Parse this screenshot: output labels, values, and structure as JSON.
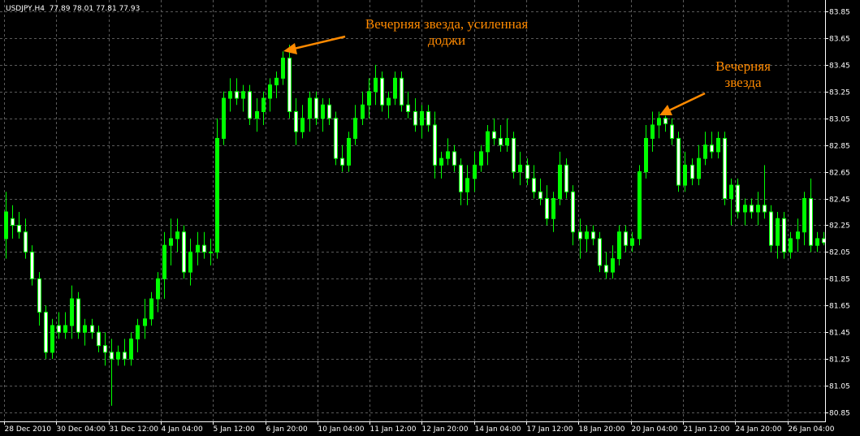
{
  "header": {
    "symbol": "USDJPY,H4",
    "ohlc": "77.89 78.01 77.81 77.93"
  },
  "annotations": [
    {
      "lines": [
        "Вечерняя звезда, усиленная",
        "доджи"
      ]
    },
    {
      "lines": [
        "Вечерняя",
        "звезда"
      ]
    }
  ],
  "colors": {
    "background": "#000000",
    "candle": "#00ff00",
    "bullish_body": "#00ff00",
    "bearish_body": "#ffffff",
    "grid": "#5a5a5a",
    "annotation": "#ff8a00",
    "text": "#ffffff"
  },
  "chart_data": {
    "type": "candlestick",
    "title": "USDJPY,H4",
    "grid": true,
    "grid_style": "dashed",
    "y_axis_position": "right",
    "ylim": [
      80.8,
      83.93
    ],
    "ytick_labels": [
      "83.85",
      "83.65",
      "83.45",
      "83.25",
      "83.05",
      "82.85",
      "82.65",
      "82.45",
      "82.25",
      "82.05",
      "81.85",
      "81.65",
      "81.45",
      "81.25",
      "81.05",
      "80.85"
    ],
    "xtick_labels": [
      "28 Dec 2010",
      "30 Dec 04:00",
      "31 Dec 12:00",
      "4 Jan 04:00",
      "5 Jan 12:00",
      "6 Jan 20:00",
      "10 Jan 04:00",
      "11 Jan 12:00",
      "12 Jan 20:00",
      "14 Jan 04:00",
      "17 Jan 12:00",
      "18 Jan 20:00",
      "20 Jan 04:00",
      "21 Jan 12:00",
      "24 Jan 20:00",
      "26 Jan 04:00"
    ],
    "series": [
      {
        "candles": [
          {
            "o": 82.15,
            "h": 82.5,
            "l": 82.0,
            "c": 82.35
          },
          {
            "o": 82.3,
            "h": 82.4,
            "l": 82.15,
            "c": 82.25
          },
          {
            "o": 82.25,
            "h": 82.35,
            "l": 82.15,
            "c": 82.2
          },
          {
            "o": 82.2,
            "h": 82.3,
            "l": 82.0,
            "c": 82.05
          },
          {
            "o": 82.05,
            "h": 82.1,
            "l": 81.8,
            "c": 81.85
          },
          {
            "o": 81.85,
            "h": 81.9,
            "l": 81.5,
            "c": 81.6
          },
          {
            "o": 81.6,
            "h": 81.65,
            "l": 81.25,
            "c": 81.3
          },
          {
            "o": 81.3,
            "h": 81.55,
            "l": 81.25,
            "c": 81.5
          },
          {
            "o": 81.5,
            "h": 81.6,
            "l": 81.4,
            "c": 81.45
          },
          {
            "o": 81.45,
            "h": 81.6,
            "l": 81.4,
            "c": 81.5
          },
          {
            "o": 81.5,
            "h": 81.8,
            "l": 81.4,
            "c": 81.7
          },
          {
            "o": 81.7,
            "h": 81.75,
            "l": 81.4,
            "c": 81.45
          },
          {
            "o": 81.45,
            "h": 81.55,
            "l": 81.35,
            "c": 81.5
          },
          {
            "o": 81.5,
            "h": 81.55,
            "l": 81.4,
            "c": 81.45
          },
          {
            "o": 81.45,
            "h": 81.5,
            "l": 81.3,
            "c": 81.35
          },
          {
            "o": 81.35,
            "h": 81.45,
            "l": 81.2,
            "c": 81.3
          },
          {
            "o": 81.3,
            "h": 81.4,
            "l": 80.9,
            "c": 81.25
          },
          {
            "o": 81.25,
            "h": 81.35,
            "l": 81.2,
            "c": 81.3
          },
          {
            "o": 81.3,
            "h": 81.4,
            "l": 81.2,
            "c": 81.25
          },
          {
            "o": 81.25,
            "h": 81.45,
            "l": 81.2,
            "c": 81.4
          },
          {
            "o": 81.4,
            "h": 81.55,
            "l": 81.3,
            "c": 81.5
          },
          {
            "o": 81.5,
            "h": 81.7,
            "l": 81.4,
            "c": 81.55
          },
          {
            "o": 81.55,
            "h": 81.75,
            "l": 81.5,
            "c": 81.7
          },
          {
            "o": 81.7,
            "h": 81.9,
            "l": 81.6,
            "c": 81.85
          },
          {
            "o": 81.85,
            "h": 82.2,
            "l": 81.7,
            "c": 82.1
          },
          {
            "o": 82.1,
            "h": 82.3,
            "l": 81.95,
            "c": 82.15
          },
          {
            "o": 82.15,
            "h": 82.3,
            "l": 82.05,
            "c": 82.2
          },
          {
            "o": 82.2,
            "h": 82.25,
            "l": 81.85,
            "c": 81.9
          },
          {
            "o": 81.9,
            "h": 82.15,
            "l": 81.8,
            "c": 82.05
          },
          {
            "o": 82.05,
            "h": 82.2,
            "l": 81.95,
            "c": 82.1
          },
          {
            "o": 82.1,
            "h": 82.2,
            "l": 82.0,
            "c": 82.05
          },
          {
            "o": 82.05,
            "h": 82.15,
            "l": 81.95,
            "c": 82.05
          },
          {
            "o": 82.05,
            "h": 83.05,
            "l": 82.0,
            "c": 82.9
          },
          {
            "o": 82.9,
            "h": 83.25,
            "l": 82.85,
            "c": 83.2
          },
          {
            "o": 83.2,
            "h": 83.35,
            "l": 83.1,
            "c": 83.25
          },
          {
            "o": 83.25,
            "h": 83.35,
            "l": 83.15,
            "c": 83.2
          },
          {
            "o": 83.2,
            "h": 83.3,
            "l": 83.1,
            "c": 83.25
          },
          {
            "o": 83.25,
            "h": 83.3,
            "l": 83.0,
            "c": 83.05
          },
          {
            "o": 83.05,
            "h": 83.2,
            "l": 82.95,
            "c": 83.1
          },
          {
            "o": 83.1,
            "h": 83.25,
            "l": 83.0,
            "c": 83.2
          },
          {
            "o": 83.2,
            "h": 83.35,
            "l": 83.1,
            "c": 83.3
          },
          {
            "o": 83.3,
            "h": 83.4,
            "l": 83.2,
            "c": 83.35
          },
          {
            "o": 83.35,
            "h": 83.55,
            "l": 83.3,
            "c": 83.5
          },
          {
            "o": 83.5,
            "h": 83.6,
            "l": 83.05,
            "c": 83.1
          },
          {
            "o": 83.1,
            "h": 83.2,
            "l": 82.85,
            "c": 82.95
          },
          {
            "o": 82.95,
            "h": 83.15,
            "l": 82.9,
            "c": 83.05
          },
          {
            "o": 83.05,
            "h": 83.25,
            "l": 82.95,
            "c": 83.2
          },
          {
            "o": 83.2,
            "h": 83.25,
            "l": 83.0,
            "c": 83.05
          },
          {
            "o": 83.05,
            "h": 83.2,
            "l": 82.95,
            "c": 83.15
          },
          {
            "o": 83.15,
            "h": 83.2,
            "l": 83.0,
            "c": 83.05
          },
          {
            "o": 83.05,
            "h": 83.1,
            "l": 82.7,
            "c": 82.75
          },
          {
            "o": 82.75,
            "h": 82.85,
            "l": 82.65,
            "c": 82.7
          },
          {
            "o": 82.7,
            "h": 82.95,
            "l": 82.65,
            "c": 82.9
          },
          {
            "o": 82.9,
            "h": 83.15,
            "l": 82.85,
            "c": 83.05
          },
          {
            "o": 83.05,
            "h": 83.25,
            "l": 83.0,
            "c": 83.15
          },
          {
            "o": 83.15,
            "h": 83.35,
            "l": 83.05,
            "c": 83.25
          },
          {
            "o": 83.25,
            "h": 83.45,
            "l": 83.15,
            "c": 83.35
          },
          {
            "o": 83.35,
            "h": 83.4,
            "l": 83.1,
            "c": 83.15
          },
          {
            "o": 83.15,
            "h": 83.25,
            "l": 83.05,
            "c": 83.2
          },
          {
            "o": 83.2,
            "h": 83.4,
            "l": 83.15,
            "c": 83.35
          },
          {
            "o": 83.35,
            "h": 83.4,
            "l": 83.1,
            "c": 83.15
          },
          {
            "o": 83.15,
            "h": 83.25,
            "l": 83.05,
            "c": 83.1
          },
          {
            "o": 83.1,
            "h": 83.2,
            "l": 82.95,
            "c": 83.0
          },
          {
            "o": 83.0,
            "h": 83.15,
            "l": 82.9,
            "c": 83.1
          },
          {
            "o": 83.1,
            "h": 83.15,
            "l": 82.95,
            "c": 83.0
          },
          {
            "o": 83.0,
            "h": 83.1,
            "l": 82.6,
            "c": 82.7
          },
          {
            "o": 82.7,
            "h": 82.8,
            "l": 82.6,
            "c": 82.75
          },
          {
            "o": 82.75,
            "h": 82.9,
            "l": 82.7,
            "c": 82.8
          },
          {
            "o": 82.8,
            "h": 82.85,
            "l": 82.65,
            "c": 82.7
          },
          {
            "o": 82.7,
            "h": 82.75,
            "l": 82.4,
            "c": 82.5
          },
          {
            "o": 82.5,
            "h": 82.7,
            "l": 82.4,
            "c": 82.6
          },
          {
            "o": 82.6,
            "h": 82.8,
            "l": 82.5,
            "c": 82.7
          },
          {
            "o": 82.7,
            "h": 82.85,
            "l": 82.65,
            "c": 82.8
          },
          {
            "o": 82.8,
            "h": 83.0,
            "l": 82.7,
            "c": 82.95
          },
          {
            "o": 82.95,
            "h": 83.05,
            "l": 82.85,
            "c": 82.9
          },
          {
            "o": 82.9,
            "h": 83.0,
            "l": 82.8,
            "c": 82.85
          },
          {
            "o": 82.85,
            "h": 83.05,
            "l": 82.8,
            "c": 82.9
          },
          {
            "o": 82.9,
            "h": 82.95,
            "l": 82.6,
            "c": 82.65
          },
          {
            "o": 82.65,
            "h": 82.8,
            "l": 82.55,
            "c": 82.7
          },
          {
            "o": 82.7,
            "h": 82.75,
            "l": 82.55,
            "c": 82.6
          },
          {
            "o": 82.6,
            "h": 82.7,
            "l": 82.45,
            "c": 82.5
          },
          {
            "o": 82.5,
            "h": 82.6,
            "l": 82.4,
            "c": 82.45
          },
          {
            "o": 82.45,
            "h": 82.55,
            "l": 82.25,
            "c": 82.3
          },
          {
            "o": 82.3,
            "h": 82.5,
            "l": 82.2,
            "c": 82.45
          },
          {
            "o": 82.45,
            "h": 82.8,
            "l": 82.4,
            "c": 82.7
          },
          {
            "o": 82.7,
            "h": 82.75,
            "l": 82.45,
            "c": 82.5
          },
          {
            "o": 82.5,
            "h": 82.55,
            "l": 82.1,
            "c": 82.2
          },
          {
            "o": 82.2,
            "h": 82.3,
            "l": 82.0,
            "c": 82.15
          },
          {
            "o": 82.15,
            "h": 82.25,
            "l": 82.05,
            "c": 82.2
          },
          {
            "o": 82.2,
            "h": 82.25,
            "l": 82.1,
            "c": 82.15
          },
          {
            "o": 82.15,
            "h": 82.2,
            "l": 81.9,
            "c": 81.95
          },
          {
            "o": 81.95,
            "h": 82.05,
            "l": 81.85,
            "c": 81.9
          },
          {
            "o": 81.9,
            "h": 82.1,
            "l": 81.85,
            "c": 82.0
          },
          {
            "o": 82.0,
            "h": 82.25,
            "l": 81.95,
            "c": 82.2
          },
          {
            "o": 82.2,
            "h": 82.25,
            "l": 82.05,
            "c": 82.1
          },
          {
            "o": 82.1,
            "h": 82.2,
            "l": 82.05,
            "c": 82.15
          },
          {
            "o": 82.15,
            "h": 82.7,
            "l": 82.1,
            "c": 82.65
          },
          {
            "o": 82.65,
            "h": 83.0,
            "l": 82.6,
            "c": 82.9
          },
          {
            "o": 82.9,
            "h": 83.1,
            "l": 82.8,
            "c": 83.0
          },
          {
            "o": 83.0,
            "h": 83.1,
            "l": 82.9,
            "c": 83.05
          },
          {
            "o": 83.05,
            "h": 83.07,
            "l": 82.95,
            "c": 83.01
          },
          {
            "o": 83.0,
            "h": 83.05,
            "l": 82.85,
            "c": 82.9
          },
          {
            "o": 82.9,
            "h": 82.95,
            "l": 82.5,
            "c": 82.55
          },
          {
            "o": 82.55,
            "h": 82.8,
            "l": 82.5,
            "c": 82.7
          },
          {
            "o": 82.7,
            "h": 82.75,
            "l": 82.55,
            "c": 82.6
          },
          {
            "o": 82.6,
            "h": 82.85,
            "l": 82.55,
            "c": 82.75
          },
          {
            "o": 82.75,
            "h": 82.95,
            "l": 82.7,
            "c": 82.85
          },
          {
            "o": 82.85,
            "h": 82.95,
            "l": 82.75,
            "c": 82.8
          },
          {
            "o": 82.8,
            "h": 82.95,
            "l": 82.75,
            "c": 82.9
          },
          {
            "o": 82.9,
            "h": 82.95,
            "l": 82.4,
            "c": 82.45
          },
          {
            "o": 82.45,
            "h": 82.6,
            "l": 82.25,
            "c": 82.55
          },
          {
            "o": 82.55,
            "h": 82.6,
            "l": 82.3,
            "c": 82.35
          },
          {
            "o": 82.35,
            "h": 82.45,
            "l": 82.25,
            "c": 82.4
          },
          {
            "o": 82.4,
            "h": 82.45,
            "l": 82.3,
            "c": 82.35
          },
          {
            "o": 82.35,
            "h": 82.5,
            "l": 82.25,
            "c": 82.4
          },
          {
            "o": 82.4,
            "h": 82.7,
            "l": 82.3,
            "c": 82.35
          },
          {
            "o": 82.35,
            "h": 82.4,
            "l": 82.05,
            "c": 82.1
          },
          {
            "o": 82.1,
            "h": 82.35,
            "l": 82.0,
            "c": 82.3
          },
          {
            "o": 82.3,
            "h": 82.35,
            "l": 82.0,
            "c": 82.05
          },
          {
            "o": 82.05,
            "h": 82.2,
            "l": 82.0,
            "c": 82.15
          },
          {
            "o": 82.15,
            "h": 82.3,
            "l": 82.05,
            "c": 82.2
          },
          {
            "o": 82.2,
            "h": 82.5,
            "l": 82.1,
            "c": 82.45
          },
          {
            "o": 82.45,
            "h": 82.6,
            "l": 82.05,
            "c": 82.1
          },
          {
            "o": 82.1,
            "h": 82.2,
            "l": 82.05,
            "c": 82.15
          },
          {
            "o": 82.15,
            "h": 82.2,
            "l": 82.1,
            "c": 82.12
          }
        ]
      }
    ]
  }
}
